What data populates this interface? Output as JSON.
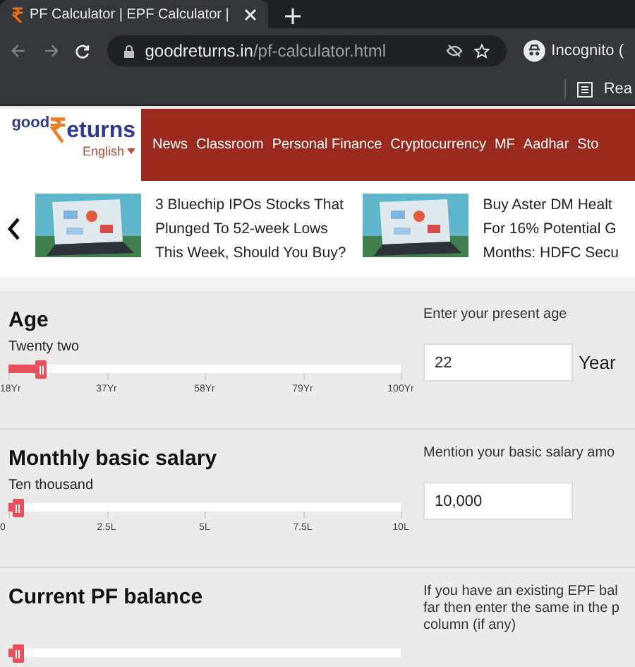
{
  "browser": {
    "tab_title": "PF Calculator | EPF Calculator |",
    "url_domain": "goodreturns.in",
    "url_path": "/pf-calculator.html",
    "profile": "Incognito (",
    "bookmark": "Rea"
  },
  "site": {
    "logo_left": "good",
    "logo_right": "eturns",
    "language": "English",
    "nav": [
      "News",
      "Classroom",
      "Personal Finance",
      "Cryptocurrency",
      "MF",
      "Aadhar",
      "Sto"
    ]
  },
  "news": [
    {
      "kind": "picture",
      "lines": [
        "3 Bluechip IPOs Stocks That",
        "Plunged To 52-week Lows",
        "This Week, Should You Buy?"
      ]
    },
    {
      "kind": "picture",
      "lines": [
        "Buy Aster DM Healt",
        "For 16% Potential G",
        "Months: HDFC Secu"
      ]
    }
  ],
  "sections": [
    {
      "title": "Age",
      "value_words": "Twenty two",
      "level": 0.07,
      "ticks": [
        "18Yr",
        "37Yr",
        "58Yr",
        "79Yr",
        "100Yr"
      ],
      "hint_lines": [
        "Enter your present age"
      ],
      "input": "22",
      "unit": "Year"
    },
    {
      "title": "Monthly basic salary",
      "value_words": "Ten thousand",
      "level": 0.01,
      "ticks": [
        "0",
        "2.5L",
        "5L",
        "7.5L",
        "10L"
      ],
      "hint_lines": [
        "Mention your basic salary amo"
      ],
      "input": "10,000"
    },
    {
      "title": "Current PF balance",
      "level": 0.01,
      "hint_lines": [
        "If you have an existing EPF bal",
        "far then enter the same in the p",
        "column (if any)"
      ]
    }
  ]
}
